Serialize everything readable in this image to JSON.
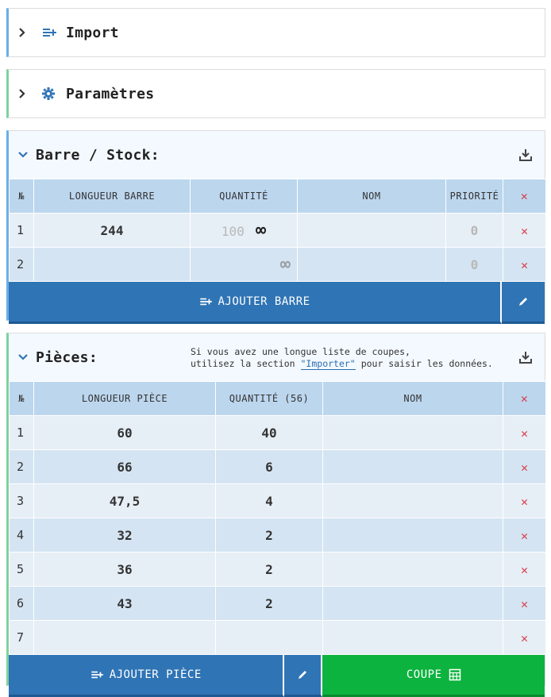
{
  "sections": {
    "import": {
      "title": "Import",
      "icon": "list-add-icon"
    },
    "params": {
      "title": "Paramètres",
      "icon": "gear-icon"
    }
  },
  "stock": {
    "title": "Barre / Stock:",
    "headers": {
      "num": "№",
      "length": "LONGUEUR BARRE",
      "qty": "QUANTITÉ",
      "name": "NOM",
      "priority": "PRIORITÉ"
    },
    "rows": [
      {
        "num": "1",
        "length": "244",
        "qty": "100",
        "infinite": "∞",
        "name": "",
        "priority": "0"
      },
      {
        "num": "2",
        "length": "",
        "qty": "",
        "infinite": "∞",
        "name": "",
        "priority": "0"
      }
    ],
    "add_label": "AJOUTER BARRE"
  },
  "pieces": {
    "title": "Pièces:",
    "note_line1": "Si vous avez une longue liste de coupes,",
    "note_line2_pre": "utilisez la section",
    "note_link": "\"Importer\"",
    "note_line2_post": "pour saisir les données.",
    "headers": {
      "num": "№",
      "length": "LONGUEUR PIÈCE",
      "qty": "QUANTITÉ (56)",
      "name": "NOM"
    },
    "rows": [
      {
        "num": "1",
        "length": "60",
        "qty": "40",
        "name": ""
      },
      {
        "num": "2",
        "length": "66",
        "qty": "6",
        "name": ""
      },
      {
        "num": "3",
        "length": "47,5",
        "qty": "4",
        "name": ""
      },
      {
        "num": "4",
        "length": "32",
        "qty": "2",
        "name": ""
      },
      {
        "num": "5",
        "length": "36",
        "qty": "2",
        "name": ""
      },
      {
        "num": "6",
        "length": "43",
        "qty": "2",
        "name": ""
      },
      {
        "num": "7",
        "length": "",
        "qty": "",
        "name": ""
      }
    ],
    "add_label": "AJOUTER PIÈCE",
    "cut_label": "COUPE"
  },
  "colors": {
    "primary": "#2f74b5",
    "success": "#0cb33e",
    "danger": "#d9404a",
    "header": "#bcd6ee"
  }
}
